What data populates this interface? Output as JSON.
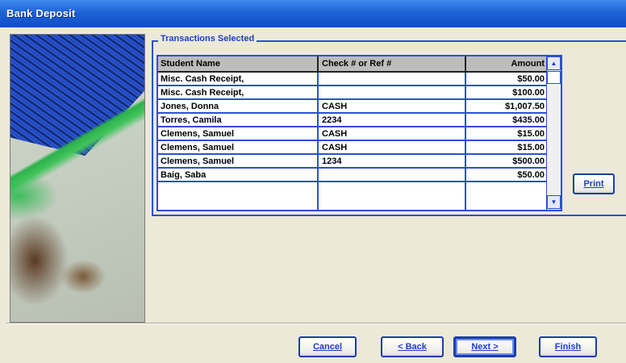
{
  "window": {
    "title": "Bank Deposit"
  },
  "group": {
    "legend": "Transactions Selected"
  },
  "table": {
    "columns": [
      "Student Name",
      "Check # or Ref #",
      "Amount"
    ],
    "rows": [
      {
        "name": "Misc. Cash Receipt,",
        "ref": "",
        "amount": "$50.00"
      },
      {
        "name": "Misc. Cash Receipt,",
        "ref": "",
        "amount": "$100.00"
      },
      {
        "name": "Jones, Donna",
        "ref": "CASH",
        "amount": "$1,007.50"
      },
      {
        "name": "Torres, Camila",
        "ref": "2234",
        "amount": "$435.00"
      },
      {
        "name": "Clemens, Samuel",
        "ref": "CASH",
        "amount": "$15.00"
      },
      {
        "name": "Clemens, Samuel",
        "ref": "CASH",
        "amount": "$15.00"
      },
      {
        "name": "Clemens, Samuel",
        "ref": "1234",
        "amount": "$500.00"
      },
      {
        "name": "Baig, Saba",
        "ref": "",
        "amount": "$50.00"
      }
    ]
  },
  "buttons": {
    "print": "Print",
    "cancel": "Cancel",
    "back": "< Back",
    "next": "Next >",
    "finish": "Finish"
  },
  "icons": {
    "scroll_up": "scroll-up-arrow-icon",
    "scroll_down": "scroll-down-arrow-icon"
  },
  "colors": {
    "accent": "#2c4fd9",
    "title_bar": "#1f62d6",
    "dialog_bg": "#ece9d8"
  }
}
